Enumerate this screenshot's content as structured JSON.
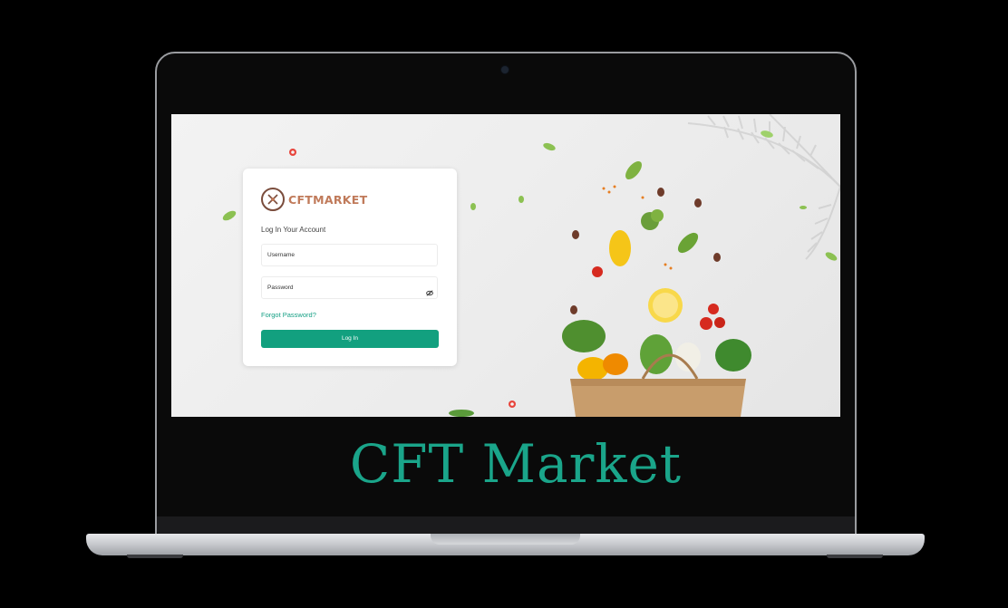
{
  "brand": {
    "logo_text": "CFTMARKET",
    "caption": "CFT Market"
  },
  "login": {
    "heading": "Log In Your Account",
    "username_placeholder": "Username",
    "password_placeholder": "Password",
    "forgot_password": "Forgot Password?",
    "login_button": "Log In"
  },
  "colors": {
    "accent": "#12a07f",
    "caption": "#1aa58a",
    "logo": "#c07a5a"
  },
  "icons": {
    "password_toggle": "eye-slash-icon",
    "logo": "cft-market-logo"
  }
}
